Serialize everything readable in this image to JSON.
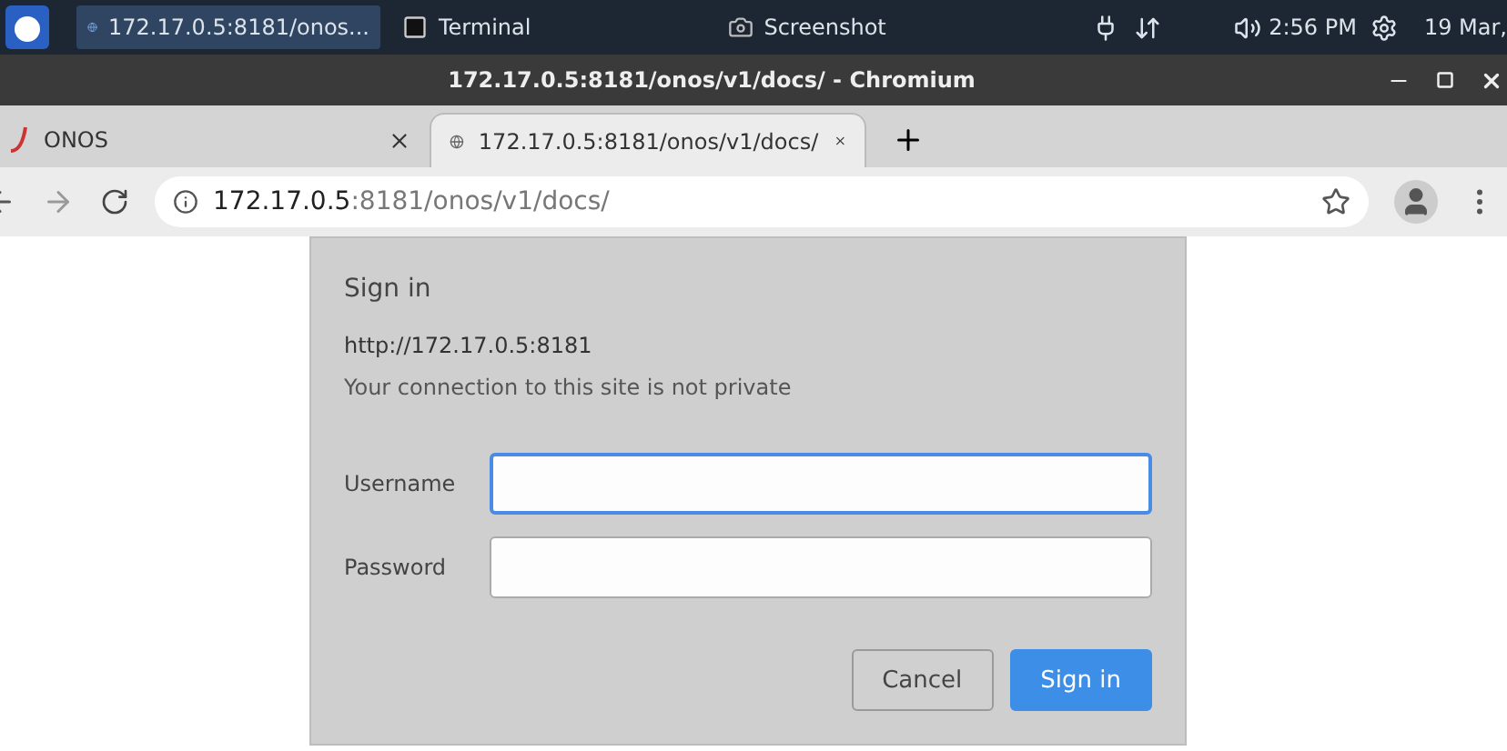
{
  "taskbar": {
    "windows": [
      {
        "label": "172.17.0.5:8181/onos...",
        "kind": "browser",
        "selected": true
      },
      {
        "label": "Terminal",
        "kind": "terminal",
        "selected": false
      },
      {
        "label": "Screenshot",
        "kind": "camera",
        "selected": false
      }
    ],
    "time": "2:56 PM",
    "date": "19 Mar,"
  },
  "window": {
    "title": "172.17.0.5:8181/onos/v1/docs/ - Chromium"
  },
  "tabs": [
    {
      "label": "ONOS",
      "kind": "onos",
      "selected": false
    },
    {
      "label": "172.17.0.5:8181/onos/v1/docs/",
      "kind": "globe",
      "selected": true
    }
  ],
  "address_bar": {
    "host": "172.17.0.5",
    "path": ":8181/onos/v1/docs/"
  },
  "dialog": {
    "title": "Sign in",
    "origin": "http://172.17.0.5:8181",
    "warning": "Your connection to this site is not private",
    "fields": [
      {
        "label": "Username",
        "focused": true
      },
      {
        "label": "Password",
        "focused": false
      }
    ],
    "buttons": [
      {
        "label": "Cancel",
        "kind": "secondary"
      },
      {
        "label": "Sign in",
        "kind": "primary"
      }
    ]
  }
}
